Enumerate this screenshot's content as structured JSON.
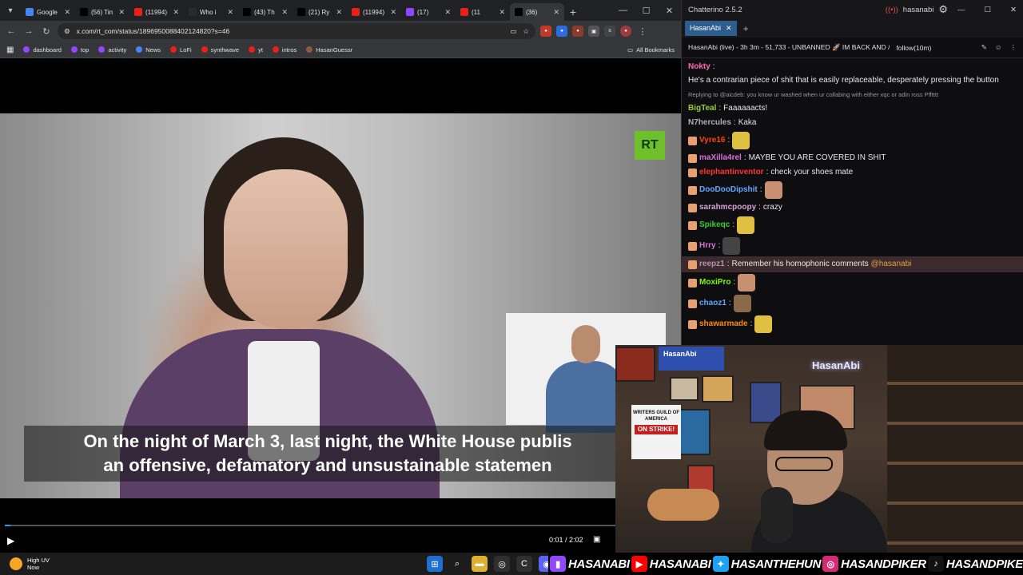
{
  "browser": {
    "tabs": [
      {
        "title": "Google",
        "favicon": "google-icon",
        "color": "#4285f4"
      },
      {
        "title": "(56) Tin",
        "favicon": "x-icon",
        "color": "#000000"
      },
      {
        "title": "(11994)",
        "favicon": "youtube-icon",
        "color": "#e62117"
      },
      {
        "title": "Who i",
        "favicon": "u-icon",
        "color": "#2a2a2a"
      },
      {
        "title": "(43) Th",
        "favicon": "x-icon",
        "color": "#000000"
      },
      {
        "title": "(21) Ry",
        "favicon": "x-icon",
        "color": "#000000"
      },
      {
        "title": "(11994)",
        "favicon": "youtube-icon",
        "color": "#e62117"
      },
      {
        "title": "(17)",
        "favicon": "twitch-icon",
        "color": "#9146ff"
      },
      {
        "title": "(11",
        "favicon": "youtube-icon",
        "color": "#e62117"
      },
      {
        "title": "(36)",
        "favicon": "x-icon",
        "color": "#000000"
      }
    ],
    "url": "x.com/rt_com/status/1896950088402124820?s=46",
    "bookmarks": [
      {
        "label": "dashboard",
        "color": "#9146ff"
      },
      {
        "label": "top",
        "color": "#9146ff"
      },
      {
        "label": "activity",
        "color": "#9146ff"
      },
      {
        "label": "News",
        "color": "#4285f4"
      },
      {
        "label": "LoFi",
        "color": "#e62117"
      },
      {
        "label": "synthwave",
        "color": "#e62117"
      },
      {
        "label": "yt",
        "color": "#e62117"
      },
      {
        "label": "intros",
        "color": "#e62117"
      },
      {
        "label": "HasanGuessr",
        "color": "#8a5a44"
      }
    ],
    "all_bookmarks": "All Bookmarks"
  },
  "video": {
    "subtitle_line1": "On the night of March 3, last night, the White House publis",
    "subtitle_line2": "an offensive, defamatory and unsustainable statemen",
    "time": "0:01 / 2:02",
    "progress": 0.008,
    "logo": "RT"
  },
  "chat": {
    "app_title": "Chatterino 2.5.2",
    "user": "hasanabi",
    "tab": "HasanAbi",
    "header": "HasanAbi (live) - 3h 3m - 51,733 - UNBANNED 🚀 IM BACK AND /",
    "follow": "follow(10m)",
    "messages": [
      {
        "user": "Nokty",
        "color": "#ff69b4",
        "text": "He's a contrarian piece of shit that is easily replaceable, desperately pressing the button"
      },
      {
        "reply": "Replying to @aicdeb: you know ur washed when ur collabing with either xqc or adin ross Pfftttt",
        "user": "BigTeal",
        "color": "#9acd32",
        "text": "Faaaaaacts!"
      },
      {
        "user": "N7hercules",
        "color": "#b0b0b0",
        "text": "Kaka"
      },
      {
        "user": "Vyre16",
        "color": "#ff4500",
        "text": ""
      },
      {
        "user": "maXilla4rel",
        "color": "#da70d6",
        "text": "MAYBE YOU ARE COVERED IN SHIT"
      },
      {
        "user": "elephantinventor",
        "color": "#ff3333",
        "text": "check your shoes mate"
      },
      {
        "user": "DooDooDipshit",
        "color": "#5fa8ff",
        "text": ""
      },
      {
        "user": "sarahmcpoopy",
        "color": "#d8a0d8",
        "text": "crazy"
      },
      {
        "user": "Spikeqc",
        "color": "#32cd32",
        "text": ""
      },
      {
        "user": "Hrry",
        "color": "#da70d6",
        "text": ""
      },
      {
        "user": "reepz1",
        "color": "#b88fb0",
        "text": "Remember his homophonic comments",
        "mention": "@hasanabi",
        "highlight": true
      },
      {
        "user": "MoxiPro",
        "color": "#7cfc00",
        "text": ""
      },
      {
        "user": "chaoz1",
        "color": "#5fa8ff",
        "text": ""
      },
      {
        "user": "shawarmade",
        "color": "#ff8c00",
        "text": ""
      }
    ]
  },
  "webcam": {
    "name_card": "HasanAbi",
    "neon": "HasanAbi",
    "strike_top": "WRITERS GUILD OF AMERICA",
    "strike_sign": "ON STRIKE!"
  },
  "socials": [
    {
      "handle": "HASANABI",
      "icon": "twitch-icon",
      "color": "#9146ff"
    },
    {
      "handle": "HASANABI",
      "icon": "youtube-icon",
      "color": "#ff0000"
    },
    {
      "handle": "HASANTHEHUN",
      "icon": "twitter-icon",
      "color": "#1da1f2"
    },
    {
      "handle": "HASANDPIKER",
      "icon": "instagram-icon",
      "color": "#d62976"
    },
    {
      "handle": "HASANDPIKER",
      "icon": "tiktok-icon",
      "color": "#111111"
    }
  ],
  "taskbar": {
    "weather_title": "High UV",
    "weather_sub": "Now"
  }
}
